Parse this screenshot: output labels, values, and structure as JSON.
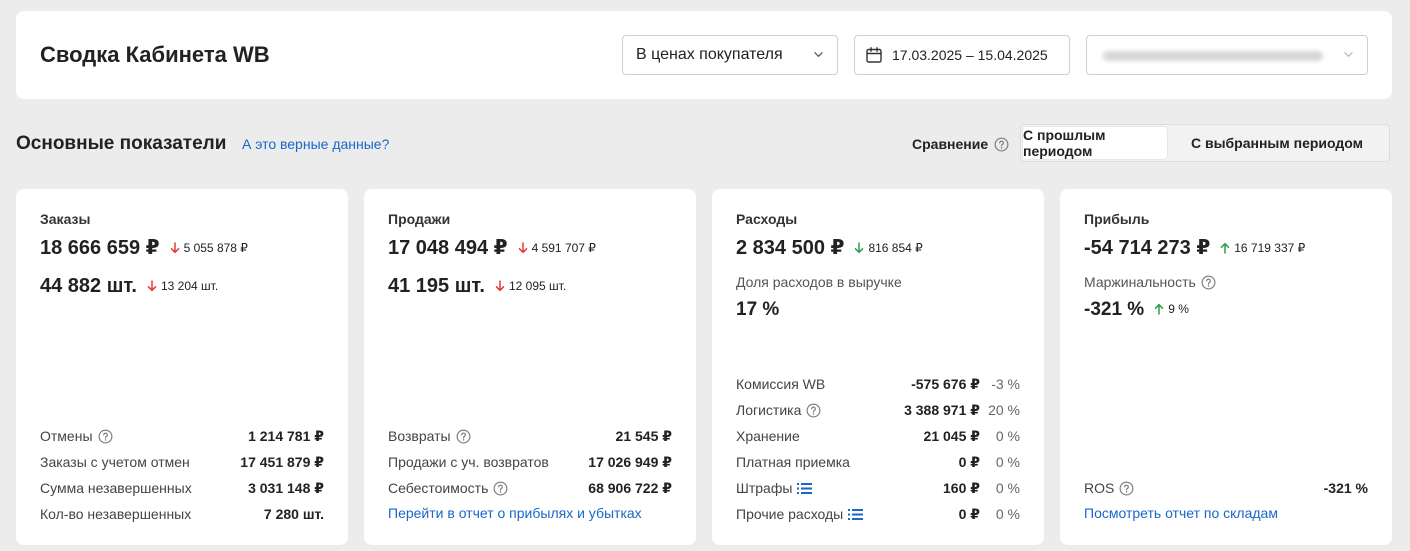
{
  "header": {
    "title": "Сводка Кабинета WB",
    "price_select": "В ценах покупателя",
    "date_range": "17.03.2025 – 15.04.2025",
    "account_select": ""
  },
  "section": {
    "title": "Основные показатели",
    "data_link": "А это верные данные?",
    "compare_label": "Сравнение",
    "compare_options": [
      "С прошлым периодом",
      "С выбранным периодом"
    ]
  },
  "colors": {
    "down": "#e53935",
    "up": "#2e9d4a",
    "link": "#1a66c9"
  },
  "cards": {
    "orders": {
      "title": "Заказы",
      "amount": "18 666 659 ₽",
      "amount_delta": "5 055 878 ₽",
      "amount_dir": "down",
      "qty": "44 882 шт.",
      "qty_delta": "13 204 шт.",
      "qty_dir": "down",
      "rows": [
        {
          "label": "Отмены",
          "value": "1 214 781 ₽",
          "help": true
        },
        {
          "label": "Заказы с учетом отмен",
          "value": "17 451 879 ₽"
        },
        {
          "label": "Сумма незавершенных",
          "value": "3 031 148 ₽"
        },
        {
          "label": "Кол-во незавершенных",
          "value": "7 280 шт."
        }
      ]
    },
    "sales": {
      "title": "Продажи",
      "amount": "17 048 494 ₽",
      "amount_delta": "4 591 707 ₽",
      "amount_dir": "down",
      "qty": "41 195 шт.",
      "qty_delta": "12 095 шт.",
      "qty_dir": "down",
      "rows": [
        {
          "label": "Возвраты",
          "value": "21 545 ₽",
          "help": true
        },
        {
          "label": "Продажи с уч. возвратов",
          "value": "17 026 949 ₽"
        },
        {
          "label": "Себестоимость",
          "value": "68 906 722 ₽",
          "help": true
        }
      ],
      "link": "Перейти в отчет о прибылях и убытках"
    },
    "expenses": {
      "title": "Расходы",
      "amount": "2 834 500 ₽",
      "amount_delta": "816 854 ₽",
      "amount_dir": "up",
      "share_label": "Доля расходов в выручке",
      "share_value": "17 %",
      "rows": [
        {
          "label": "Комиссия WB",
          "value": "-575 676 ₽",
          "pct": "-3 %"
        },
        {
          "label": "Логистика",
          "value": "3 388 971 ₽",
          "pct": "20 %",
          "help": true
        },
        {
          "label": "Хранение",
          "value": "21 045 ₽",
          "pct": "0 %"
        },
        {
          "label": "Платная приемка",
          "value": "0 ₽",
          "pct": "0 %"
        },
        {
          "label": "Штрафы",
          "value": "160 ₽",
          "pct": "0 %",
          "list": true
        },
        {
          "label": "Прочие расходы",
          "value": "0 ₽",
          "pct": "0 %",
          "list": true
        }
      ]
    },
    "profit": {
      "title": "Прибыль",
      "amount": "-54 714 273 ₽",
      "amount_delta": "16 719 337 ₽",
      "amount_dir": "up",
      "margin_label": "Маржинальность",
      "margin_value": "-321 %",
      "margin_delta": "9 %",
      "margin_dir": "up",
      "rows": [
        {
          "label": "ROS",
          "value": "-321 %",
          "help": true
        }
      ],
      "link": "Посмотреть отчет по складам"
    }
  }
}
